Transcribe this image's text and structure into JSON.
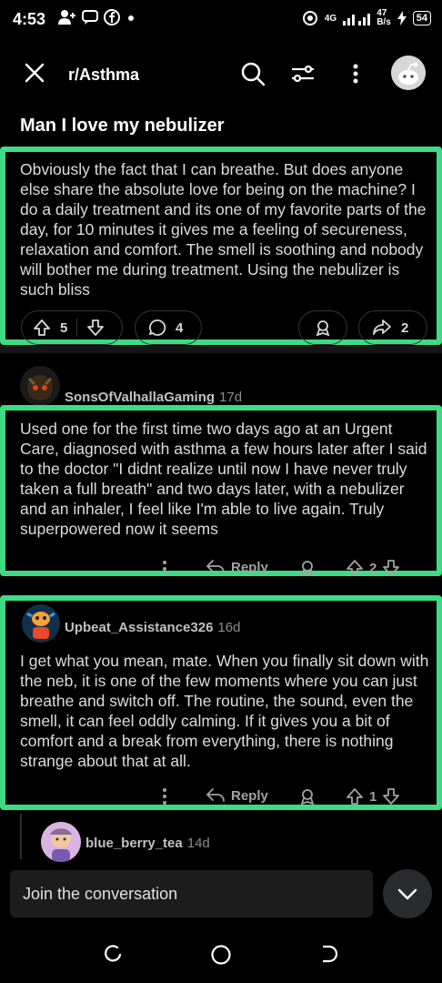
{
  "status_bar": {
    "time": "4:53",
    "network_type": "4G",
    "data_speed_top": "47",
    "data_speed_unit": "B/s",
    "battery": "54"
  },
  "header": {
    "subreddit": "r/Asthma"
  },
  "post": {
    "title": "Man I love my nebulizer",
    "body": "Obviously the fact that I can breathe. But does anyone else share the absolute love for being on the machine? I do a daily treatment and its one of my favorite parts of the day, for 10 minutes it gives me a feeling of secureness, relaxation and comfort. The smell is soothing and nobody will bother me during treatment. Using the nebulizer is such bliss",
    "upvotes": "5",
    "comments": "4",
    "shares": "2"
  },
  "comments": [
    {
      "username": "SonsOfValhallaGaming",
      "age": "17d",
      "body": "Used one for the first time two days ago at an Urgent Care, diagnosed with asthma a few hours later after I said to the doctor \"I didnt realize until now I have never truly taken a full breath\" and two days later, with a nebulizer and an inhaler, I feel like I'm able to live again. Truly superpowered now it seems",
      "reply_label": "Reply",
      "votes": "2"
    },
    {
      "username": "Upbeat_Assistance326",
      "age": "16d",
      "body": "I get what you mean, mate. When you finally sit down with the neb, it is one of the few moments where you can just breathe and switch off. The routine, the sound, even the smell, it can feel oddly calming. If it gives you a bit of comfort and a break from everything, there is nothing strange about that at all.",
      "reply_label": "Reply",
      "votes": "1"
    },
    {
      "username": "blue_berry_tea",
      "age": "14d"
    }
  ],
  "compose": {
    "placeholder": "Join the conversation"
  },
  "colors": {
    "highlight": "#3ddc84",
    "background": "#000000"
  }
}
